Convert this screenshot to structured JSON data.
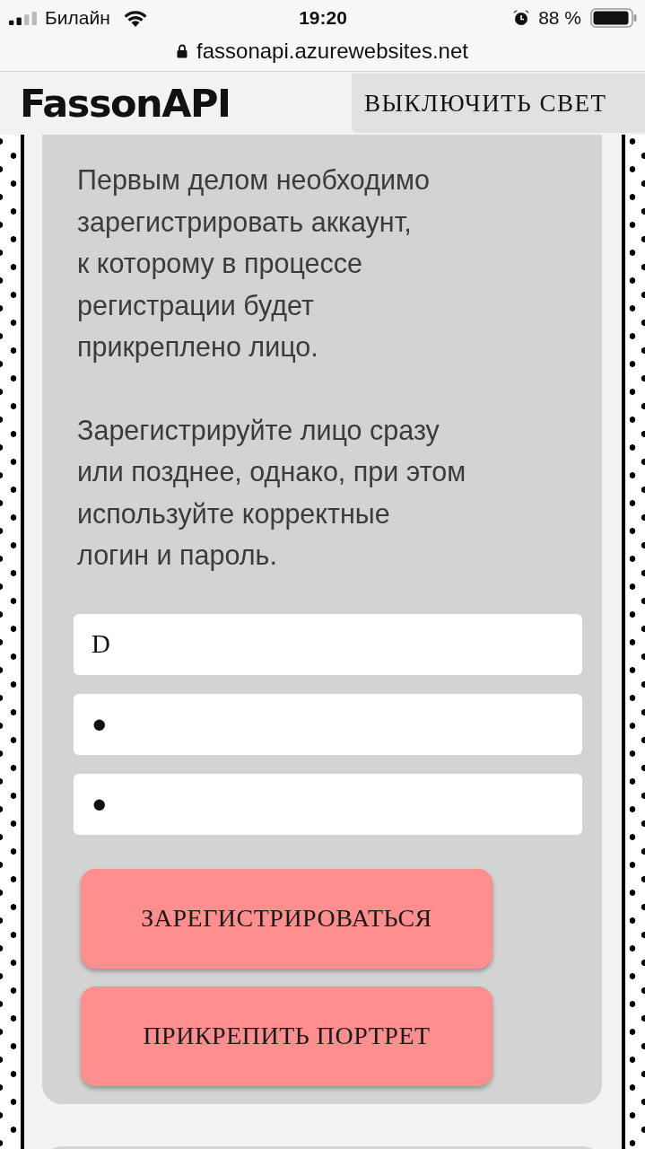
{
  "status_bar": {
    "carrier": "Билайн",
    "time": "19:20",
    "battery": "88 %"
  },
  "address_bar": {
    "url": "fassonapi.azurewebsites.net"
  },
  "header": {
    "logo": "FassonAPI",
    "light_button": "ВЫКЛЮЧИТЬ СВЕТ"
  },
  "form": {
    "paragraphs": [
      [
        "Первым делом необходимо",
        "зарегистрировать аккаунт,",
        "к которому в процессе",
        "регистрации будет",
        "прикреплено лицо."
      ],
      [
        "Зарегистрируйте лицо сразу",
        "или позднее, однако, при этом",
        "используйте корректные",
        "логин и пароль."
      ]
    ],
    "fields": [
      {
        "value": "D"
      },
      {
        "value": "●"
      },
      {
        "value": "●"
      }
    ],
    "buttons": [
      "ЗАРЕГИСТРИРОВАТЬСЯ",
      "ПРИКРЕПИТЬ ПОРТРЕТ"
    ]
  }
}
